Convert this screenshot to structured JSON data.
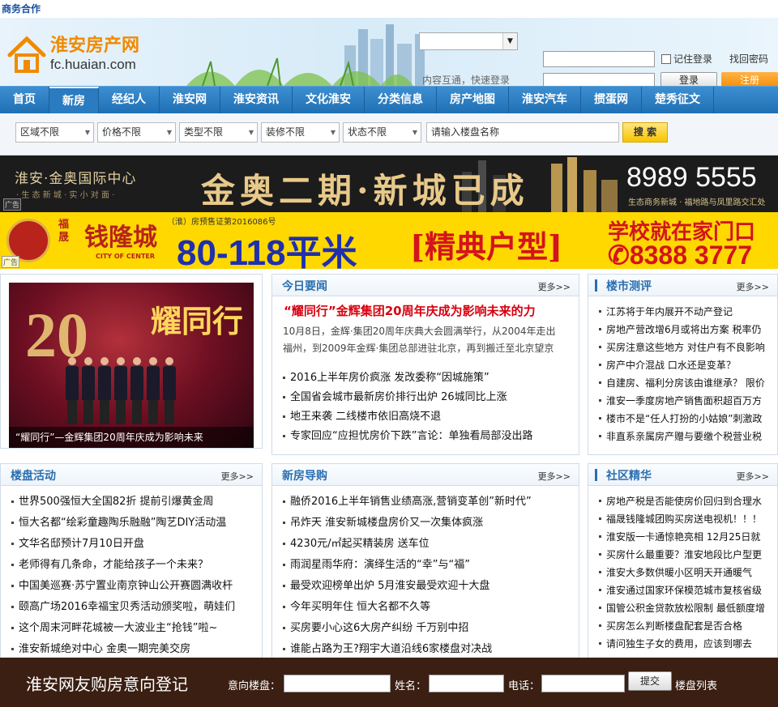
{
  "topbar": {
    "label": "商务合作"
  },
  "header": {
    "logo_cn": "淮安房产网",
    "logo_domain": "fc.huaian.com",
    "site_select_value": "",
    "note": "内容互通，快速登录",
    "remember": "记住登录",
    "find_password": "找回密码",
    "login": "登录",
    "register": "注册"
  },
  "nav": {
    "items": [
      "首页",
      "新房",
      "经纪人",
      "淮安网",
      "淮安资讯",
      "文化淮安",
      "分类信息",
      "房产地图",
      "淮安汽车",
      "掼蛋网",
      "楚秀征文"
    ],
    "active": "新房"
  },
  "filter": {
    "area": "区域不限",
    "price": "价格不限",
    "type": "类型不限",
    "decor": "装修不限",
    "status": "状态不限",
    "search_placeholder": "请输入楼盘名称",
    "search_btn": "搜 索"
  },
  "ads": {
    "ad1": {
      "left": "淮安·金奥国际中心",
      "sub": "· 生 态 新 城 · 实 小 对 面 ·",
      "slogan": "金奥二期·新城已成",
      "phone": "8989 5555",
      "addr": "生态商务新城 · 福地路与凤里路交汇处",
      "tag": "广告"
    },
    "ad2": {
      "brand_small": "福晟",
      "brand": "钱隆城",
      "brand_en": "CITY OF CENTER",
      "cert": "（淮）房预售证第2016086号",
      "area": "80-118平米",
      "type": "[精典户型]",
      "school": "学校就在家门口",
      "tel": "✆8388 3777",
      "tag": "广告"
    }
  },
  "photo": {
    "caption": "“耀同行”—金辉集团20周年庆成为影响未来",
    "big": "20",
    "banner": "耀同行"
  },
  "today": {
    "title": "今日要闻",
    "more": "更多>>",
    "headline": "“耀同行”金辉集团20周年庆成为影响未来的力",
    "summary": "10月8日，金辉·集团20周年庆典大会圆满举行，从2004年走出福州，到2009年金辉·集团总部进驻北京，再到搬迁至北京望京金辉",
    "items": [
      "2016上半年房价疯涨 发改委称“因城施策”",
      "全国省会城市最新房价排行出炉 26城同比上涨",
      "地王来袭 二线楼市依旧高烧不退",
      "专家回应“应担忧房价下跌”言论：单独看局部没出路"
    ]
  },
  "market": {
    "title": "楼市测评",
    "more": "更多>>",
    "items": [
      "江苏将于年内展开不动产登记",
      "房地产营改增6月或将出方案 税率仍",
      "买房注意这些地方 对住户有不良影响",
      "房产中介混战 口水还是变革？",
      "自建房、福利分房该由谁继承？ 限价",
      "淮安一季度房地产销售面积超百万方",
      "楼市不是“任人打扮的小姑娘”刺激政",
      "非直系亲属房产赠与要缴个税营业税"
    ]
  },
  "activity": {
    "title": "楼盘活动",
    "more": "更多>>",
    "items": [
      "世界500强恒大全国82折 提前引爆黄金周",
      "恒大名都“绘彩童趣陶乐融融”陶艺DIY活动温",
      "文华名邸预计7月10日开盘",
      "老师得有几条命，才能给孩子一个未来？",
      "中国美巡赛·苏宁置业南京钟山公开赛圆满收杆",
      "颐高广场2016幸福宝贝秀活动颁奖啦，萌娃们",
      "这个周末河畔花城被一大波业主“抢钱”啦~",
      "淮安新城绝对中心 金奥一期完美交房"
    ]
  },
  "guide": {
    "title": "新房导购",
    "more": "更多>>",
    "items": [
      "融侨2016上半年销售业绩高涨,营销变革创”新时代”",
      "吊炸天 淮安新城楼盘房价又一次集体疯涨",
      "4230元/㎡起买精装房 送车位",
      "雨润星雨华府：演绎生活的“幸”与“福”",
      "最受欢迎榜单出炉 5月淮安最受欢迎十大盘",
      "今年买明年住 恒大名都不久等",
      "买房要小心这6大房产纠纷 千万别中招",
      "谁能占路为王?翔宇大道沿线6家楼盘对决战"
    ]
  },
  "community": {
    "title": "社区精华",
    "more": "更多>>",
    "items": [
      "房地产税是否能使房价回归到合理水",
      "福晟钱隆城团购买房送电视机！！！",
      "淮安版一卡通惊艳亮相 12月25日就",
      "买房什么最重要？淮安地段比户型更",
      "淮安大多数供暖小区明天开通暖气",
      "淮安通过国家环保模范城市复核省级",
      "国管公积金贷款放松限制 最低额度增",
      "买房怎么判断楼盘配套是否合格",
      "请问独生子女的费用，应该到哪去"
    ]
  },
  "register": {
    "title": "淮安网友购房意向登记",
    "l_estate": "意向楼盘：",
    "l_name": "姓名：",
    "l_phone": "电话：",
    "submit": "提交",
    "list": "楼盘列表"
  },
  "colors": {
    "nav": "#1f6fb5",
    "accent": "#f08a00",
    "headline": "#d7000f"
  }
}
